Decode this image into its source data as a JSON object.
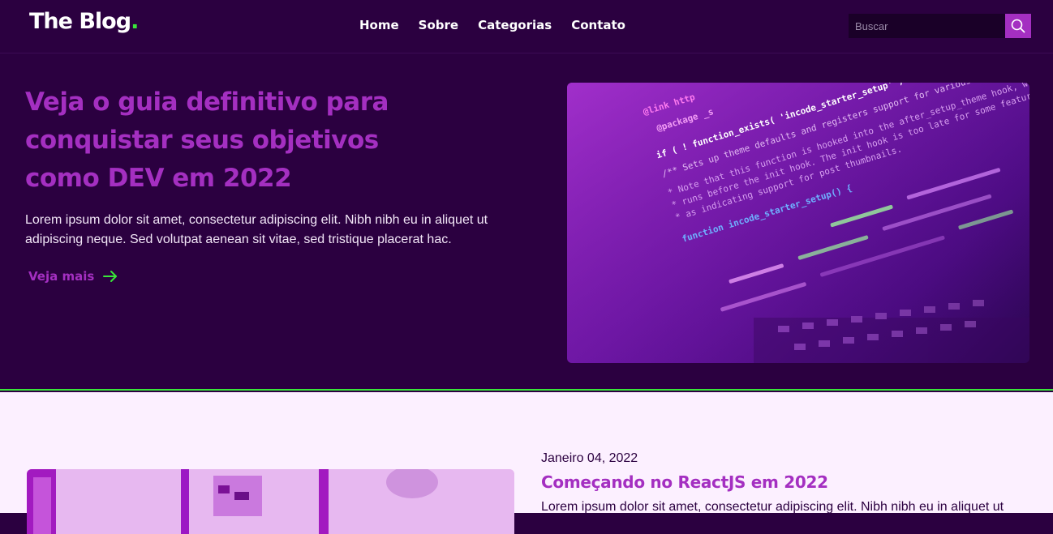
{
  "header": {
    "logo_text": "The Blog",
    "logo_dot": ".",
    "nav": [
      "Home",
      "Sobre",
      "Categorias",
      "Contato"
    ],
    "search": {
      "placeholder": "Buscar",
      "icon": "search-icon"
    }
  },
  "hero": {
    "title": "Veja o guia definitivo para conquistar seus objetivos como DEV em 2022",
    "text": "Lorem ipsum dolor sit amet, consectetur adipiscing elit. Nibh nibh eu in aliquet ut adipiscing neque. Sed volutpat aenean sit vitae, sed tristique placerat hac.",
    "link_label": "Veja mais",
    "link_icon": "arrow-right-icon",
    "code_lines": [
      "@link http",
      "@package _s",
      "if ( ! function_exists( 'incode_starter_setup' ) ) :",
      "/** Sets up theme defaults and registers support for various WordPress",
      " * Note that this function is hooked into the after_setup_theme hook, which",
      " * runs before the init hook. The init hook is too late for some features, such",
      " * as indicating support for post thumbnails.",
      "function incode_starter_setup() {"
    ]
  },
  "post": {
    "date": "Janeiro 04, 2022",
    "title": "Começando no ReactJS em 2022",
    "excerpt": "Lorem ipsum dolor sit amet, consectetur adipiscing elit. Nibh nibh eu in aliquet ut"
  },
  "colors": {
    "background": "#2b0040",
    "accent": "#a42fc1",
    "green": "#39e639",
    "light_section": "#fcf0ff"
  }
}
